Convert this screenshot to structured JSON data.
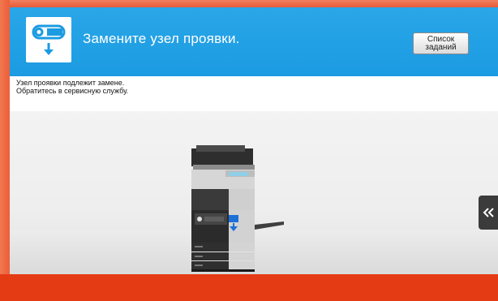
{
  "header": {
    "title": "Замените узел проявки.",
    "jobs_button_label_line1": "Список",
    "jobs_button_label_line2": "заданий",
    "icon": "developing-unit-replace-icon"
  },
  "message": {
    "line1": "Узел проявки подлежит замене.",
    "line2": "Обратитесь в сервисную службу."
  },
  "illustration": {
    "device": "mfp-printer-illustration",
    "indicator_icon": "replace-arrow-icon"
  },
  "side_panel": {
    "icon": "double-chevron-left-icon"
  },
  "colors": {
    "header_blue": "#1b9be2",
    "alert_red": "#e43b14",
    "accent_orange": "#ec5f3a"
  }
}
